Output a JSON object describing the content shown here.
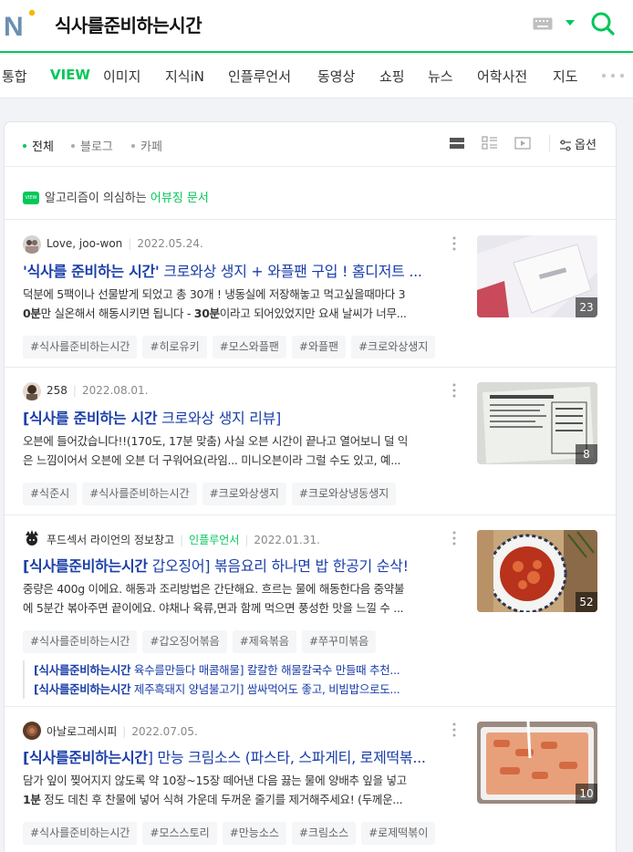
{
  "header": {
    "query": "식사를준비하는시간"
  },
  "tabs": [
    "통합",
    "VIEW",
    "이미지",
    "지식iN",
    "인플루언서",
    "동영상",
    "쇼핑",
    "뉴스",
    "어학사전",
    "지도"
  ],
  "active_tab": "VIEW",
  "filters": {
    "items": [
      "전체",
      "블로그",
      "카페"
    ],
    "active": "전체",
    "options_label": "옵션"
  },
  "algorithm_notice": {
    "badge": "VIEW",
    "text": "알고리즘이 의심하는 ",
    "link": "어뷰징 문서"
  },
  "results": [
    {
      "author": "Love, joo-won",
      "date": "2022.05.24.",
      "influencer_label": "",
      "title_bold": "'식사를 준비하는 시간'",
      "title_rest": " 크로와상 생지 + 와플팬 구입 ! 홈디저트 ...",
      "desc_line1": "덕분에 5팩이나 선물받게 되었고 총 30개 ! 냉동실에 저장해놓고 먹고싶을때마다 3",
      "desc_line2_bold": "0분",
      "desc_line2_mid": "만 실온해서 해동시키면 됩니다 - ",
      "desc_line2_bold2": "30분",
      "desc_line2_rest": "이라고 되어있었지만 요새 날씨가 너무...",
      "tags": [
        "#식사를준비하는시간",
        "#히로유키",
        "#모스와플팬",
        "#와플팬",
        "#크로와상생지"
      ],
      "thumb_count": "23",
      "related": []
    },
    {
      "author": "258",
      "date": "2022.08.01.",
      "influencer_label": "",
      "title_bold": "[식사를 준비하는 시간",
      "title_rest": " 크로와상 생지 리뷰]",
      "desc_line1": "오븐에 들어갔습니다!!(170도, 17분 맞춤) 사실 오븐 시간이 끝나고 열어보니 덜 익",
      "desc_line2_bold": "",
      "desc_line2_mid": "은 느낌이어서 오븐에 오븐 더 구워어요(라임... 미니오븐이라 그럴 수도 있고, 예...",
      "desc_line2_bold2": "",
      "desc_line2_rest": "",
      "tags": [
        "#식준시",
        "#식사를준비하는시간",
        "#크로와상생지",
        "#크로와상냉동생지"
      ],
      "thumb_count": "8",
      "related": []
    },
    {
      "author": "푸드섹서 라이언의 정보창고",
      "date": "2022.01.31.",
      "influencer_label": "인플루언서",
      "title_bold": "[식사를준비하는시간",
      "title_rest": " 갑오징어] 볶음요리 하나면 밥 한공기 순삭!",
      "desc_line1": "중량은 400g 이에요. 해동과 조리방법은 간단해요. 흐르는 물에 해동한다음 중약불",
      "desc_line2_bold": "",
      "desc_line2_mid": "에 5분간 볶아주면 끝이에요. 야채나 육류,면과 함께 먹으면 풍성한 맛을 느낄 수 ...",
      "desc_line2_bold2": "",
      "desc_line2_rest": "",
      "tags": [
        "#식사를준비하는시간",
        "#갑오징어볶음",
        "#제육볶음",
        "#쭈꾸미볶음"
      ],
      "thumb_count": "52",
      "related": [
        {
          "bold": "[식사를준비하는시간",
          "rest": " 육수를만들다 매콤해물] 칼칼한 해물칼국수 만들때 추천..."
        },
        {
          "bold": "[식사를준비하는시간",
          "rest": " 제주흑돼지 양념불고기] 쌈싸먹어도 좋고, 비빔밥으로도..."
        }
      ]
    },
    {
      "author": "아날로그레시피",
      "date": "2022.07.05.",
      "influencer_label": "",
      "title_bold": "[식사를준비하는시간",
      "title_rest": "] 만능 크림소스 (파스타, 스파게티, 로제떡볶...",
      "desc_line1": "담가 잎이 찢어지지 않도록 약 10장~15장 떼어낸 다음 끓는 물에 양배추 잎을 넣고",
      "desc_line2_bold": "1분",
      "desc_line2_mid": " 정도 데친 후 찬물에 넣어 식혀 가운데 두꺼운 줄기를 제거해주세요! (두께운...",
      "desc_line2_bold2": "",
      "desc_line2_rest": "",
      "tags": [
        "#식사를준비하는시간",
        "#모스스토리",
        "#만능소스",
        "#크림소스",
        "#로제떡볶이"
      ],
      "thumb_count": "10",
      "related": []
    }
  ],
  "colors": {
    "brand_green": "#03c75a",
    "link_blue": "#1a3ea9"
  }
}
